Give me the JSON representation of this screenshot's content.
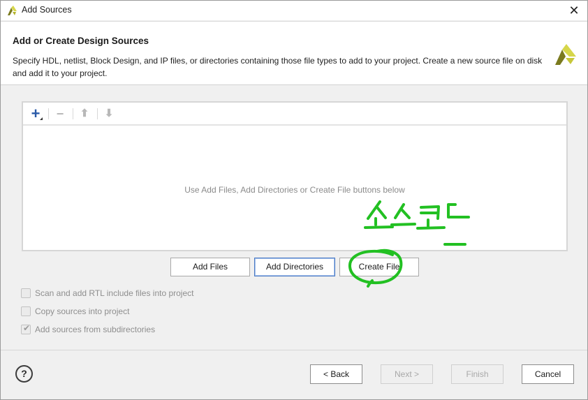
{
  "window": {
    "title": "Add Sources",
    "close_glyph": "✕"
  },
  "header": {
    "title": "Add or Create Design Sources",
    "description": "Specify HDL, netlist, Block Design, and IP files, or directories containing those file types to add to your project. Create a new source file on disk and add it to your project."
  },
  "toolbar": {
    "add_glyph": "+",
    "remove_glyph": "−",
    "up_glyph": "⬆",
    "down_glyph": "⬇"
  },
  "file_panel": {
    "empty_message": "Use Add Files, Add Directories or Create File buttons below"
  },
  "actions": {
    "add_files": "Add Files",
    "add_directories": "Add Directories",
    "create_file": "Create File"
  },
  "options": [
    {
      "label": "Scan and add RTL include files into project",
      "checked": false
    },
    {
      "label": "Copy sources into project",
      "checked": false
    },
    {
      "label": "Add sources from subdirectories",
      "checked": true
    }
  ],
  "footer": {
    "help": "?",
    "back": "< Back",
    "next": "Next >",
    "finish": "Finish",
    "cancel": "Cancel"
  },
  "annotation": {
    "text": "소스코드",
    "color": "#22c022"
  },
  "colors": {
    "logo_dark": "#7a7a1e",
    "logo_light": "#d6d64a",
    "accent": "#4a79c4"
  }
}
